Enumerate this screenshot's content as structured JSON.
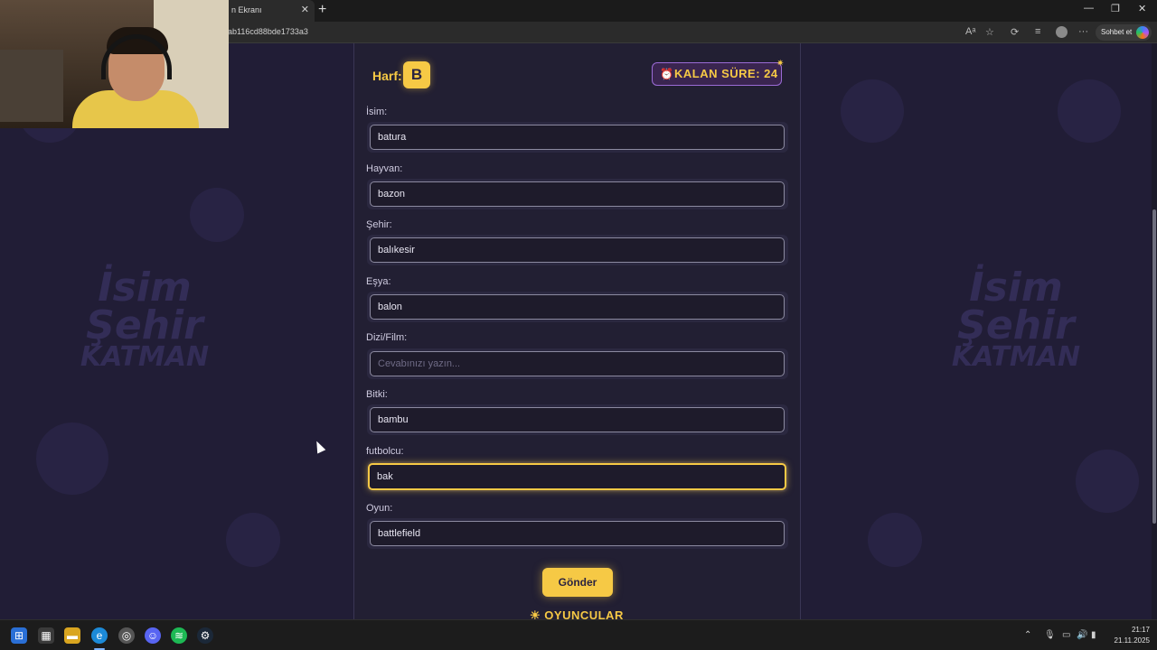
{
  "browser": {
    "tab_title": "n Ekranı",
    "tab_close": "✕",
    "new_tab": "+",
    "url": "ab116cd88bde1733a3",
    "chat_button": "Sohbet et",
    "window_controls": [
      "—",
      "❐",
      "✕"
    ]
  },
  "game": {
    "harf_label": "Harf:",
    "harf_value": "B",
    "timer_text": "KALAN SÜRE: 24",
    "fields": [
      {
        "label": "İsim:",
        "value": "batura",
        "placeholder": ""
      },
      {
        "label": "Hayvan:",
        "value": "bazon",
        "placeholder": ""
      },
      {
        "label": "Şehir:",
        "value": "balıkesir",
        "placeholder": ""
      },
      {
        "label": "Eşya:",
        "value": "balon",
        "placeholder": ""
      },
      {
        "label": "Dizi/Film:",
        "value": "",
        "placeholder": "Cevabınızı yazın..."
      },
      {
        "label": "Bitki:",
        "value": "bambu",
        "placeholder": ""
      },
      {
        "label": "futbolcu:",
        "value": "bak",
        "placeholder": ""
      },
      {
        "label": "Oyun:",
        "value": "battlefield",
        "placeholder": ""
      }
    ],
    "submit_label": "Gönder",
    "players_title": "OYUNCULAR",
    "background_logo": [
      "İsim",
      "Şehir",
      "KATMAN"
    ]
  },
  "taskbar": {
    "clock_time": "21:17",
    "clock_date": "21.11.2025",
    "apps": [
      "start",
      "store",
      "file-explorer",
      "edge",
      "chrome",
      "discord",
      "spotify",
      "steam"
    ]
  },
  "colors": {
    "accent": "#f6c945",
    "panel_bg": "#221f33",
    "page_bg": "#211d36",
    "timer_border": "#9b6bd6"
  }
}
